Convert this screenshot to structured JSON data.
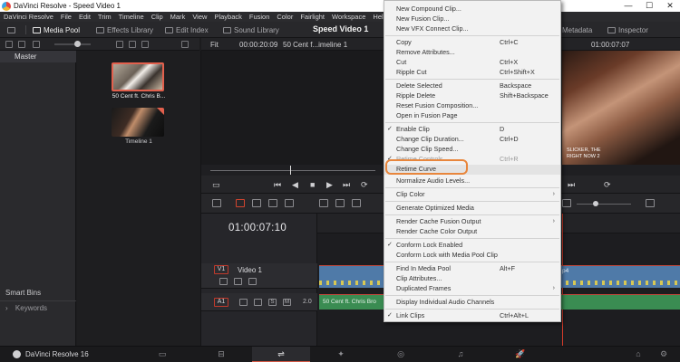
{
  "titlebar": {
    "title": "DaVinci Resolve - Speed Video 1",
    "min": "—",
    "max": "☐",
    "close": "✕"
  },
  "menubar": {
    "items": [
      "DaVinci Resolve",
      "File",
      "Edit",
      "Trim",
      "Timeline",
      "Clip",
      "Mark",
      "View",
      "Playback",
      "Fusion",
      "Color",
      "Fairlight",
      "Workspace",
      "Help"
    ]
  },
  "toolbar": {
    "media_pool": "Media Pool",
    "effects_library": "Effects Library",
    "edit_index": "Edit Index",
    "sound_library": "Sound Library",
    "project_title": "Speed Video 1",
    "metadata": "Metadata",
    "inspector": "Inspector"
  },
  "media_pool": {
    "master": "Master",
    "smart_bins": "Smart Bins",
    "keywords": "Keywords",
    "keywords_arrow": "›"
  },
  "clips": [
    {
      "label": "50 Cent ft. Chris B...",
      "selected": true
    },
    {
      "label": "Timeline 1",
      "selected": false
    }
  ],
  "viewer": {
    "fit": "Fit",
    "source_timecode": "00:00:20:09",
    "timeline_name": "50 Cent f...imeline 1",
    "record_timecode": "01:00:07:07",
    "subtitle_line1": "SLICKER, THE",
    "subtitle_line2": "RIGHT NOW 2"
  },
  "timeline": {
    "timecode": "01:00:07:10",
    "v1_badge": "V1",
    "v1_name": "Video 1",
    "a1_badge": "A1",
    "a1_level": "2.0",
    "audio_clip_label": "50 Cent ft. Chris Bro",
    "video_clip_label": "p4",
    "mini_s": "S",
    "mini_m": "M"
  },
  "bottombar": {
    "brand": "DaVinci Resolve 16"
  },
  "context_menu": {
    "items": [
      {
        "label": "New Compound Clip...",
        "shortcut": ""
      },
      {
        "label": "New Fusion Clip...",
        "shortcut": ""
      },
      {
        "label": "New VFX Connect Clip...",
        "shortcut": ""
      },
      {
        "label": "Copy",
        "shortcut": "Ctrl+C"
      },
      {
        "label": "Remove Attributes...",
        "shortcut": ""
      },
      {
        "label": "Cut",
        "shortcut": "Ctrl+X"
      },
      {
        "label": "Ripple Cut",
        "shortcut": "Ctrl+Shift+X"
      },
      {
        "label": "Delete Selected",
        "shortcut": "Backspace"
      },
      {
        "label": "Ripple Delete",
        "shortcut": "Shift+Backspace"
      },
      {
        "label": "Reset Fusion Composition...",
        "shortcut": ""
      },
      {
        "label": "Open in Fusion Page",
        "shortcut": ""
      },
      {
        "label": "Enable Clip",
        "shortcut": "D",
        "checked": true
      },
      {
        "label": "Change Clip Duration...",
        "shortcut": "Ctrl+D"
      },
      {
        "label": "Change Clip Speed...",
        "shortcut": ""
      },
      {
        "label": "Retime Controls",
        "shortcut": "Ctrl+R",
        "checked": true
      },
      {
        "label": "Retime Curve",
        "shortcut": ""
      },
      {
        "label": "Normalize Audio Levels...",
        "shortcut": ""
      },
      {
        "label": "Clip Color",
        "shortcut": "",
        "submenu": true
      },
      {
        "label": "Generate Optimized Media",
        "shortcut": ""
      },
      {
        "label": "Render Cache Fusion Output",
        "shortcut": "",
        "submenu": true
      },
      {
        "label": "Render Cache Color Output",
        "shortcut": ""
      },
      {
        "label": "Conform Lock Enabled",
        "shortcut": "",
        "checked": true
      },
      {
        "label": "Conform Lock with Media Pool Clip",
        "shortcut": ""
      },
      {
        "label": "Find In Media Pool",
        "shortcut": "Alt+F"
      },
      {
        "label": "Clip Attributes...",
        "shortcut": ""
      },
      {
        "label": "Duplicated Frames",
        "shortcut": "",
        "submenu": true
      },
      {
        "label": "Display Individual Audio Channels",
        "shortcut": ""
      },
      {
        "label": "Link Clips",
        "shortcut": "Ctrl+Alt+L",
        "checked": true
      }
    ],
    "check_glyph": "✓",
    "arrow_glyph": "›"
  },
  "icons": {
    "media_pool": "media-pool-icon",
    "effects": "effects-library-icon",
    "edit_index": "edit-index-icon",
    "sound": "sound-library-icon",
    "metadata": "metadata-icon",
    "inspector": "inspector-icon"
  },
  "transport": {
    "prev_clip": "⏮",
    "step_back": "◀",
    "stop": "■",
    "play": "▶",
    "next_clip": "⏭",
    "loop": "⟳"
  },
  "pages": {
    "media": "▭",
    "cut": "⊟",
    "edit": "⇌",
    "fusion": "✦",
    "color": "◎",
    "fairlight": "♫",
    "deliver": "🚀",
    "home": "⌂",
    "settings": "⚙"
  },
  "accent_colors": {
    "selection": "#e2604d",
    "callout": "#e8863c",
    "playhead": "#d33b2a",
    "video_clip": "#4f7aa8",
    "audio_clip": "#3a8c52"
  }
}
